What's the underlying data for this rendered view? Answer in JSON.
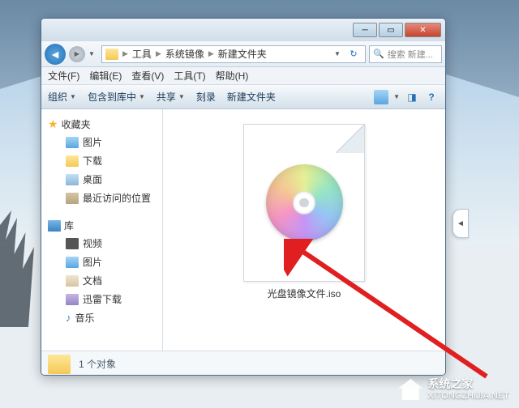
{
  "breadcrumb": {
    "item1": "工具",
    "item2": "系统镜像",
    "item3": "新建文件夹"
  },
  "search": {
    "placeholder": "搜索 新建..."
  },
  "menu": {
    "file": "文件(F)",
    "edit": "编辑(E)",
    "view": "查看(V)",
    "tools": "工具(T)",
    "help": "帮助(H)"
  },
  "toolbar": {
    "organize": "组织",
    "include": "包含到库中",
    "share": "共享",
    "burn": "刻录",
    "newfolder": "新建文件夹"
  },
  "sidebar": {
    "favorites": "收藏夹",
    "favitems": {
      "pictures": "图片",
      "downloads": "下载",
      "desktop": "桌面",
      "recent": "最近访问的位置"
    },
    "library": "库",
    "libitems": {
      "video": "视频",
      "pictures": "图片",
      "docs": "文档",
      "xunlei": "迅雷下载",
      "music": "音乐"
    }
  },
  "file": {
    "name": "光盘镜像文件.iso"
  },
  "status": {
    "count": "1 个对象"
  },
  "watermark": {
    "title": "系统之家",
    "url": "XITONGZHIJIA.NET"
  }
}
